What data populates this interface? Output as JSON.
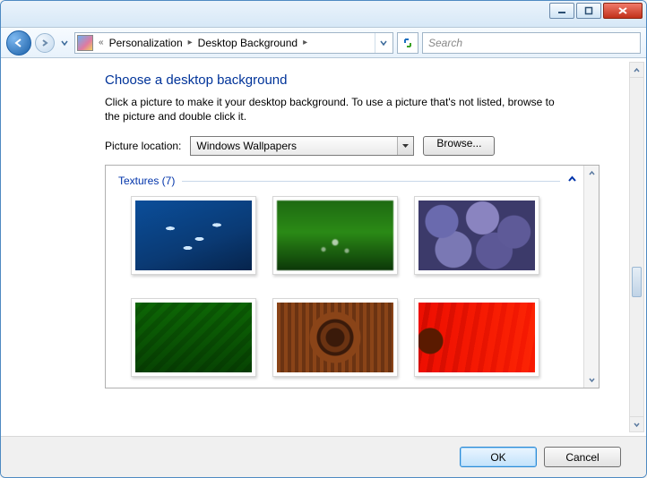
{
  "breadcrumb": {
    "level1": "Personalization",
    "level2": "Desktop Background"
  },
  "search": {
    "placeholder": "Search"
  },
  "page": {
    "title": "Choose a desktop background",
    "description": "Click a picture to make it your desktop background. To use a picture that's not listed, browse to the picture and double click it."
  },
  "location": {
    "label": "Picture location:",
    "value": "Windows Wallpapers",
    "browse": "Browse..."
  },
  "group": {
    "label": "Textures (7)"
  },
  "buttons": {
    "ok": "OK",
    "cancel": "Cancel"
  }
}
